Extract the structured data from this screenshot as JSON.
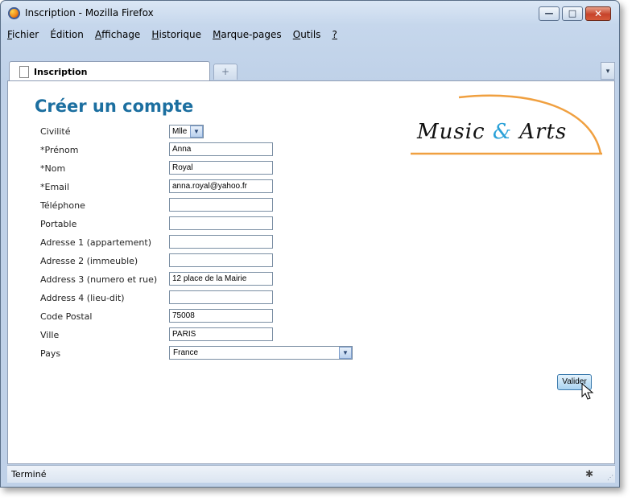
{
  "window": {
    "title": "Inscription - Mozilla Firefox",
    "controls": {
      "minimize": "—",
      "maximize": "□",
      "close": "✕"
    }
  },
  "menu": [
    {
      "u": "F",
      "rest": "ichier"
    },
    {
      "pre": "É",
      "u": "",
      "rest": "dition"
    },
    {
      "u": "A",
      "rest": "ffichage"
    },
    {
      "u": "H",
      "rest": "istorique"
    },
    {
      "u": "M",
      "rest": "arque-pages"
    },
    {
      "u": "O",
      "rest": "utils"
    },
    {
      "u": "?",
      "rest": ""
    }
  ],
  "tab": {
    "label": "Inscription",
    "newtab": "+",
    "list": "▾"
  },
  "page": {
    "title": "Créer un compte",
    "logo": {
      "word1": "Music",
      "amp": "&",
      "word2": "Arts"
    },
    "fields": [
      {
        "label": "Civilité",
        "type": "select",
        "value": "Mlle"
      },
      {
        "label": "*Prénom",
        "value": "Anna"
      },
      {
        "label": "*Nom",
        "value": "Royal"
      },
      {
        "label": "*Email",
        "value": "anna.royal@yahoo.fr"
      },
      {
        "label": "Téléphone",
        "value": ""
      },
      {
        "label": "Portable",
        "value": ""
      },
      {
        "label": "Adresse 1 (appartement)",
        "value": ""
      },
      {
        "label": "Adresse 2 (immeuble)",
        "value": ""
      },
      {
        "label": "Address 3 (numero et rue)",
        "value": "12 place de la Mairie"
      },
      {
        "label": "Address 4 (lieu-dit)",
        "value": ""
      },
      {
        "label": "Code Postal",
        "value": "75008"
      },
      {
        "label": "Ville",
        "value": "PARIS"
      },
      {
        "label": "Pays",
        "type": "select",
        "value": "France"
      }
    ],
    "submit": "Valider"
  },
  "status": {
    "text": "Terminé"
  },
  "colors": {
    "title": "#1c6fa0",
    "logo_arc": "#f0a040",
    "amp": "#2aa1d8"
  }
}
